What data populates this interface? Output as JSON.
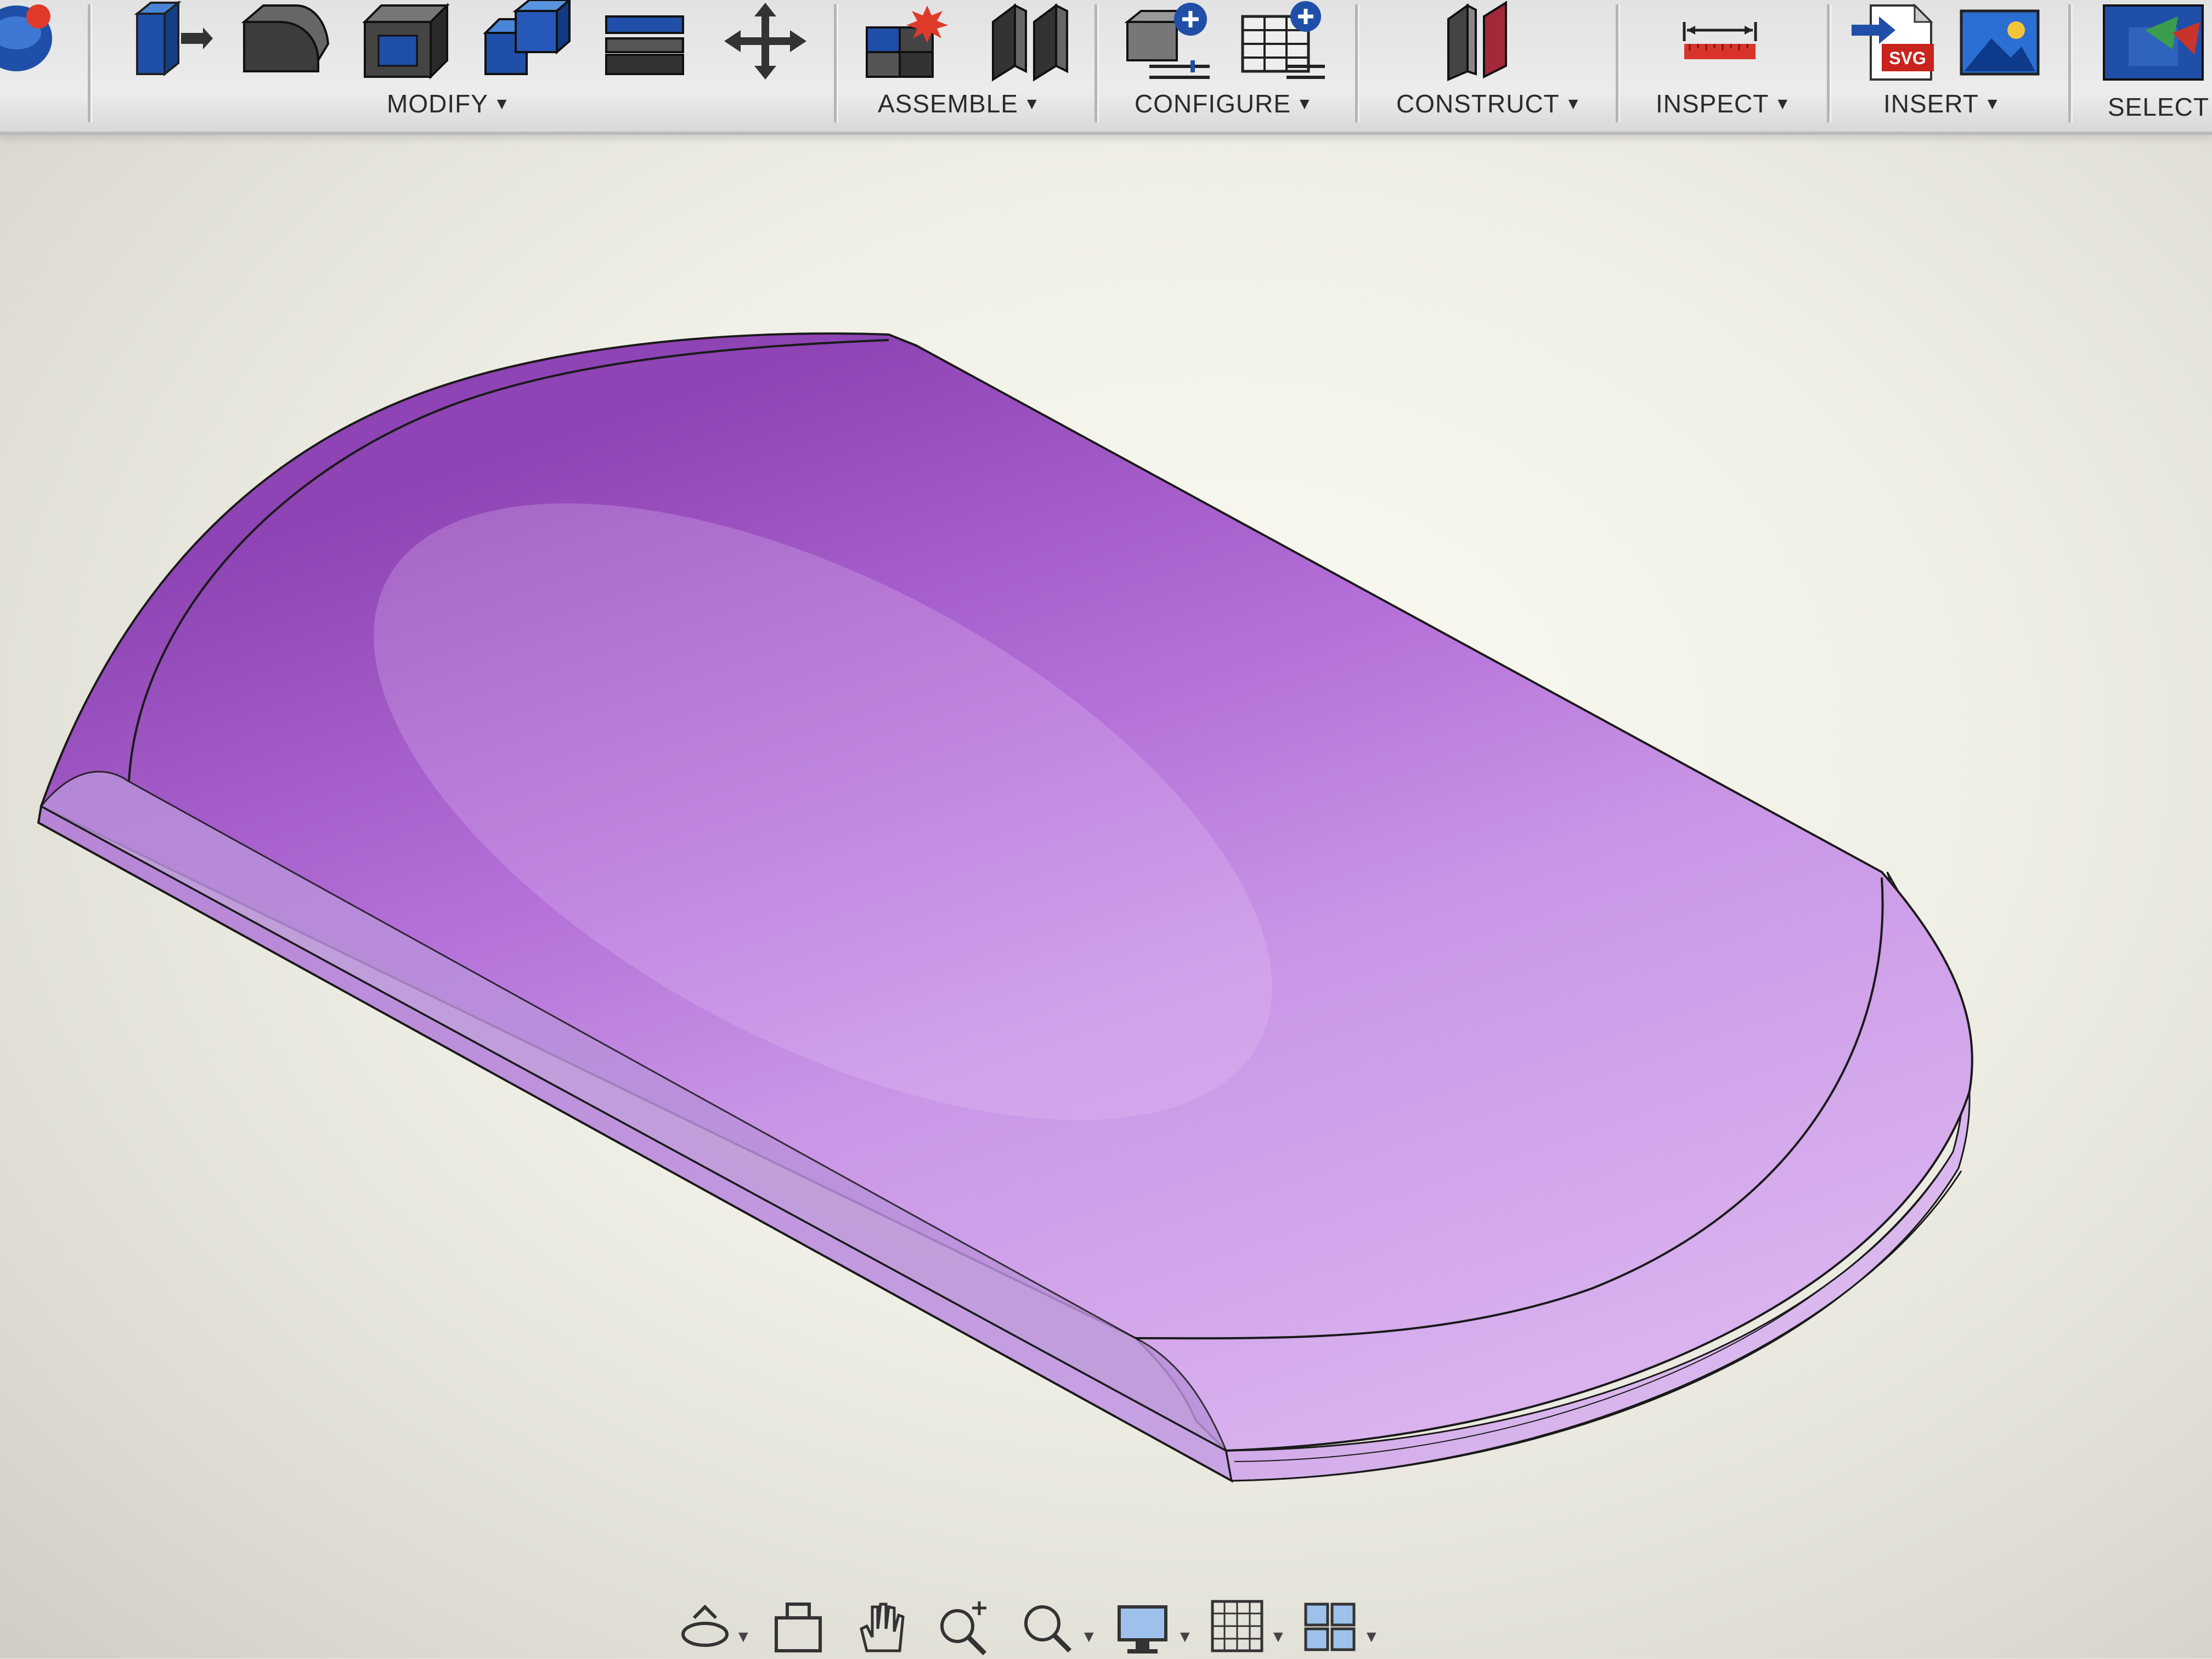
{
  "toolbar": {
    "groups": [
      {
        "label": "MODIFY"
      },
      {
        "label": "ASSEMBLE"
      },
      {
        "label": "CONFIGURE"
      },
      {
        "label": "CONSTRUCT"
      },
      {
        "label": "INSPECT"
      },
      {
        "label": "INSERT"
      },
      {
        "label": "SELECT"
      }
    ],
    "caret": "▼",
    "insert_svg_badge": "SVG"
  },
  "icons": {
    "modify": [
      "press-pull-icon",
      "fillet-icon",
      "shell-icon",
      "combine-icon",
      "replace-face-icon",
      "move-icon"
    ],
    "assemble": [
      "new-component-icon",
      "joint-icon"
    ],
    "configure": [
      "configure-model-icon",
      "configuration-table-icon"
    ],
    "construct": [
      "offset-plane-icon"
    ],
    "inspect": [
      "measure-icon"
    ],
    "insert": [
      "insert-svg-icon",
      "insert-image-icon"
    ],
    "select": [
      "select-icon"
    ],
    "navigation": [
      "orbit-icon",
      "look-at-icon",
      "pan-icon",
      "zoom-icon",
      "fit-icon",
      "display-settings-icon",
      "grid-icon",
      "viewports-icon"
    ]
  },
  "colors": {
    "body_top": "#b47ad8",
    "body_side": "#a77cc9",
    "accent_blue": "#1f4fa8",
    "toolbar_bg": "#e4e4e4"
  }
}
